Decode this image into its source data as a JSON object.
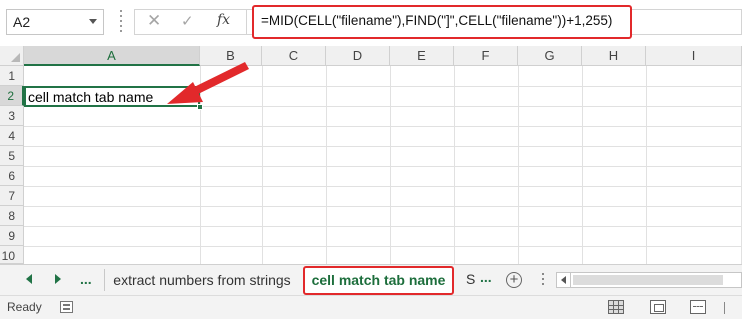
{
  "formula_bar": {
    "name_box": "A2",
    "cancel_icon": "x-icon",
    "enter_icon": "checkmark-icon",
    "function_label": "fx",
    "formula": "=MID(CELL(\"filename\"),FIND(\"]\",CELL(\"filename\"))+1,255)"
  },
  "grid": {
    "columns": [
      "A",
      "B",
      "C",
      "D",
      "E",
      "F",
      "G",
      "H",
      "I"
    ],
    "rows": [
      "1",
      "2",
      "3",
      "4",
      "5",
      "6",
      "7",
      "8",
      "9",
      "10"
    ],
    "active_column": "A",
    "active_row": "2",
    "cells": {
      "A2": "cell match tab name"
    }
  },
  "sheet_tabs": {
    "more_tabs_left": "...",
    "tabs": [
      {
        "label": "extract numbers from strings",
        "active": false
      },
      {
        "label": "cell match tab name",
        "active": true
      }
    ],
    "partial_tab": "S",
    "more_tabs_right": "...",
    "add_sheet": "+"
  },
  "status_bar": {
    "status": "Ready"
  },
  "colors": {
    "excel_green": "#217346",
    "highlight_red": "#e2292b",
    "header_gray": "#f0f0f0",
    "gridline": "#e1e1e1"
  }
}
